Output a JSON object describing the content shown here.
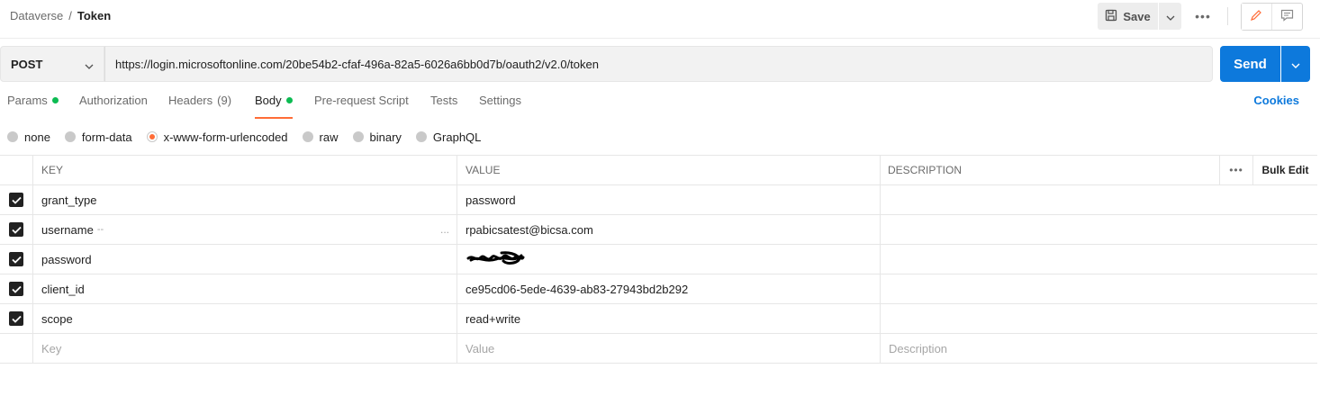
{
  "breadcrumb": {
    "parent": "Dataverse",
    "separator": "/",
    "current": "Token"
  },
  "toolbar": {
    "save_label": "Save",
    "more_label": "•••"
  },
  "request": {
    "method": "POST",
    "url": "https://login.microsoftonline.com/20be54b2-cfaf-496a-82a5-6026a6bb0d7b/oauth2/v2.0/token",
    "send_label": "Send"
  },
  "tabs": [
    {
      "label": "Params",
      "dot": true
    },
    {
      "label": "Authorization"
    },
    {
      "label": "Headers",
      "count": "(9)"
    },
    {
      "label": "Body",
      "dot": true,
      "active": true
    },
    {
      "label": "Pre-request Script"
    },
    {
      "label": "Tests"
    },
    {
      "label": "Settings"
    }
  ],
  "cookies_label": "Cookies",
  "body_types": [
    {
      "label": "none"
    },
    {
      "label": "form-data"
    },
    {
      "label": "x-www-form-urlencoded",
      "selected": true
    },
    {
      "label": "raw"
    },
    {
      "label": "binary"
    },
    {
      "label": "GraphQL"
    }
  ],
  "table": {
    "headers": {
      "key": "KEY",
      "value": "VALUE",
      "description": "DESCRIPTION",
      "more": "•••",
      "bulk_edit": "Bulk Edit"
    },
    "rows": [
      {
        "checked": true,
        "key": "grant_type",
        "value": "password",
        "description": ""
      },
      {
        "checked": true,
        "key": "username",
        "key_hint": "--",
        "key_dots": "...",
        "value": "rpabicsatest@bicsa.com",
        "description": ""
      },
      {
        "checked": true,
        "key": "password",
        "value": "",
        "value_redacted": true,
        "description": ""
      },
      {
        "checked": true,
        "key": "client_id",
        "value": "ce95cd06-5ede-4639-ab83-27943bd2b292",
        "description": ""
      },
      {
        "checked": true,
        "key": "scope",
        "value": "read+write",
        "description": ""
      }
    ],
    "placeholders": {
      "key": "Key",
      "value": "Value",
      "description": "Description"
    }
  },
  "colors": {
    "accent": "#ff6c37",
    "primary": "#0d79dc",
    "status_dot": "#0cbb52"
  }
}
